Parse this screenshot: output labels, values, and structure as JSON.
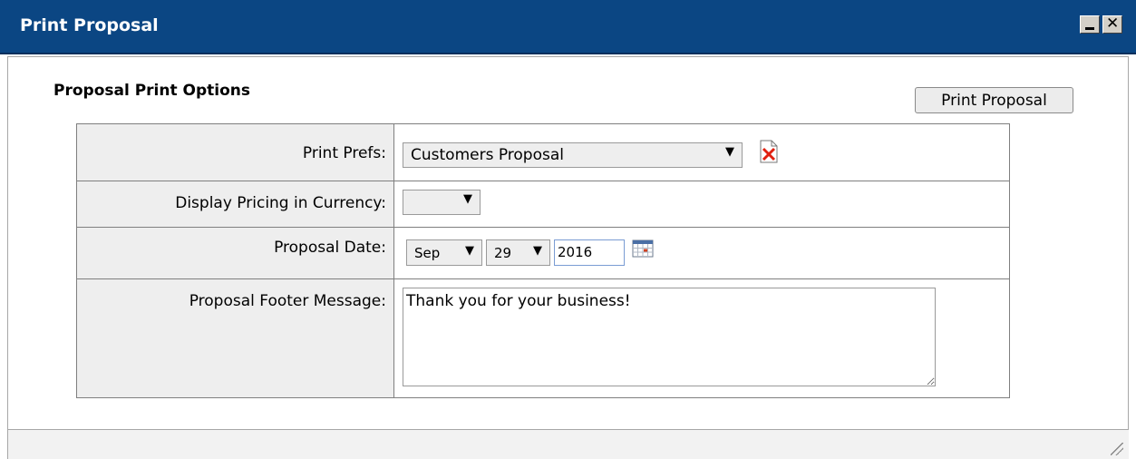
{
  "window": {
    "title": "Print Proposal",
    "min_glyph": "_",
    "close_glyph": "✕"
  },
  "section": {
    "heading": "Proposal Print Options",
    "print_button": "Print Proposal"
  },
  "form": {
    "print_prefs": {
      "label": "Print Prefs:",
      "value": "Customers Proposal",
      "clear_icon": "delete-document-icon"
    },
    "currency": {
      "label": "Display Pricing in Currency:",
      "value": ""
    },
    "date": {
      "label": "Proposal Date:",
      "month": "Sep",
      "day": "29",
      "year": "2016",
      "calendar_icon": "calendar-icon"
    },
    "footer": {
      "label": "Proposal Footer Message:",
      "value": "Thank you for your business!"
    }
  },
  "colors": {
    "titlebar": "#0b4683",
    "label_bg": "#eeeeee"
  }
}
